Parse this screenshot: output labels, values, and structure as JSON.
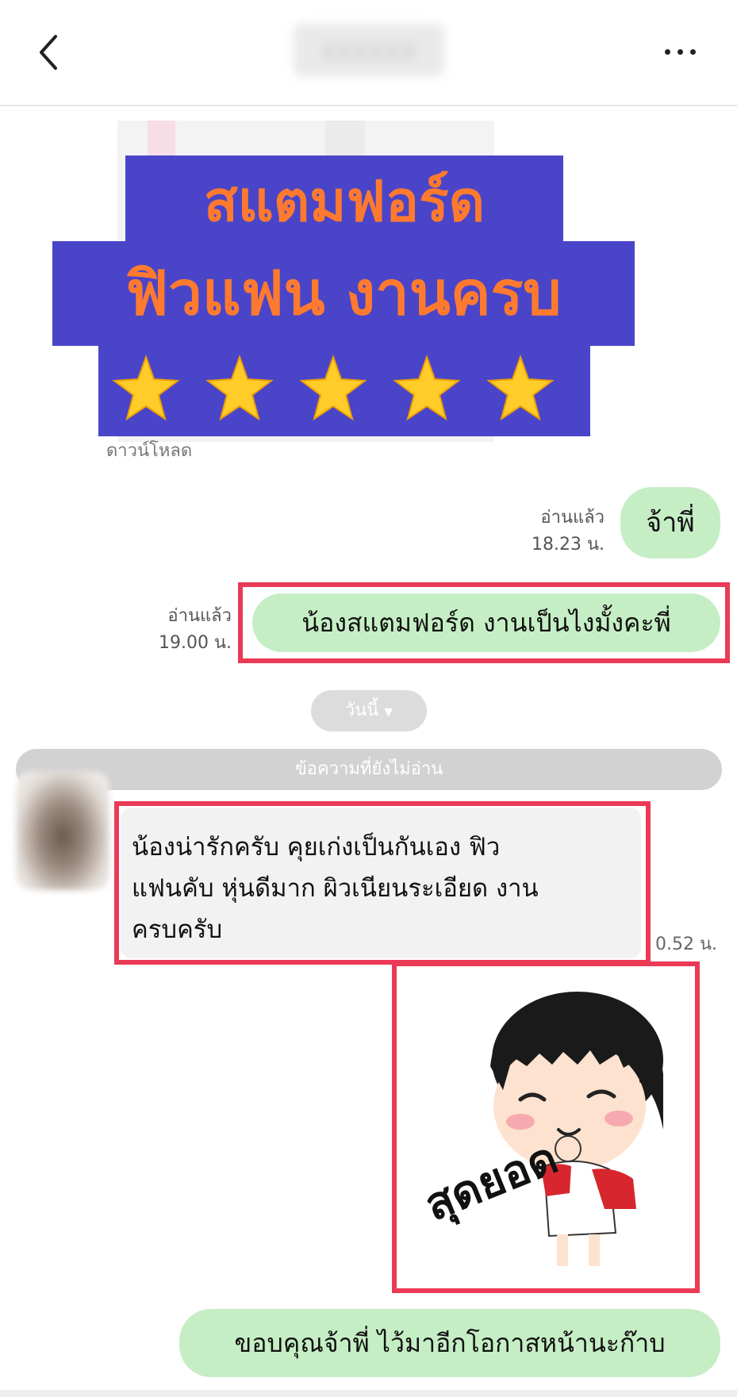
{
  "header": {
    "contact_name": "xxxxxx"
  },
  "promo": {
    "line1": "สแตมฟอร์ด",
    "line2": "ฟิวแฟน งานครบ",
    "rating": 5,
    "download_label": "ดาวน์โหลด"
  },
  "messages": [
    {
      "side": "out",
      "text": "จ้าพี่",
      "status": "อ่านแล้ว",
      "time": "18.23 น."
    },
    {
      "side": "out",
      "text": "น้องสแตมฟอร์ด งานเป็นไงมั้งคะพี่",
      "status": "อ่านแล้ว",
      "time": "19.00 น."
    },
    {
      "side": "in",
      "text_lines": [
        "น้องน่ารักครับ คุยเก่งเป็นกันเอง ฟิว",
        "แฟนคับ หุ่นดีมาก ผิวเนียนระเอียด งาน",
        "ครบครับ"
      ],
      "time": "0.52 น."
    },
    {
      "side": "in",
      "type": "sticker",
      "sticker_text": "สุดยอด"
    },
    {
      "side": "out",
      "text": "ขอบคุณจ้าพี่ ไว้มาอีกโอกาสหน้านะก๊าบ"
    }
  ],
  "date_separator": "วันนี้",
  "unread_label": "ข้อความที่ยังไม่อ่าน",
  "colors": {
    "banner_bg": "#4a45c8",
    "banner_text": "#ff7a2f",
    "outgoing_bubble": "#c6eec5",
    "highlight_border": "#ea3a56"
  },
  "icons": [
    "back-arrow-icon",
    "more-icon",
    "star-icon",
    "caret-down-icon"
  ]
}
